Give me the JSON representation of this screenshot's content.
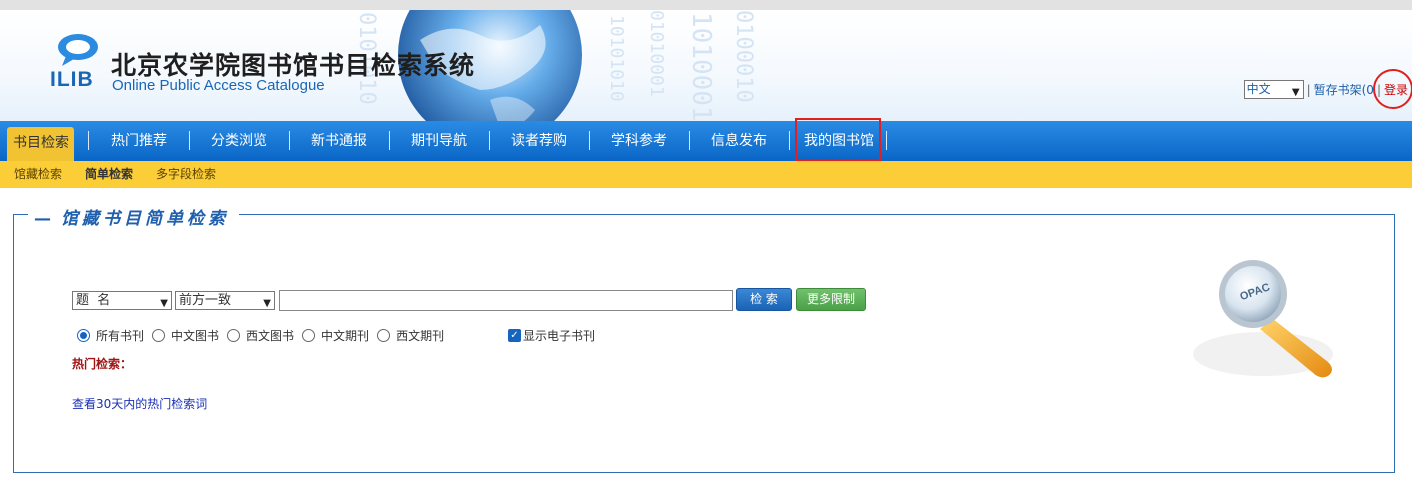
{
  "header": {
    "title_cn": "北京农学院图书馆书目检索系统",
    "title_en": "Online Public Access Catalogue",
    "logo_text": "ILIB",
    "background_digits": [
      "0101010",
      "10101010",
      "01010001",
      "1010001",
      "0100010"
    ]
  },
  "toplinks": {
    "language": "中文",
    "shelf": "暂存书架(0",
    "separator": "|",
    "login": "登录"
  },
  "nav": {
    "items": [
      "书目检索",
      "热门推荐",
      "分类浏览",
      "新书通报",
      "期刊导航",
      "读者荐购",
      "学科参考",
      "信息发布",
      "我的图书馆"
    ]
  },
  "subnav": {
    "items": [
      "馆藏检索",
      "简单检索",
      "多字段检索"
    ]
  },
  "search": {
    "panel_title": "馆藏书目简单检索",
    "field": "题  名",
    "mode": "前方一致",
    "keyword": "",
    "search_button": "检 索",
    "more_button": "更多限制",
    "radios": [
      {
        "label": "所有书刊",
        "checked": true
      },
      {
        "label": "中文图书",
        "checked": false
      },
      {
        "label": "西文图书",
        "checked": false
      },
      {
        "label": "中文期刊",
        "checked": false
      },
      {
        "label": "西文期刊",
        "checked": false
      }
    ],
    "show_ejournal": {
      "label": "显示电子书刊",
      "checked": true
    },
    "hot_label": "热门检索：",
    "hot_link": "查看30天内的热门检索词",
    "opac_badge": "OPAC"
  },
  "colors": {
    "nav_blue": "#0a66c6",
    "subnav_yellow": "#fbcd36",
    "active_tab": "#f1c232",
    "highlight_red": "#e02020",
    "panel_border": "#2e6db6"
  }
}
